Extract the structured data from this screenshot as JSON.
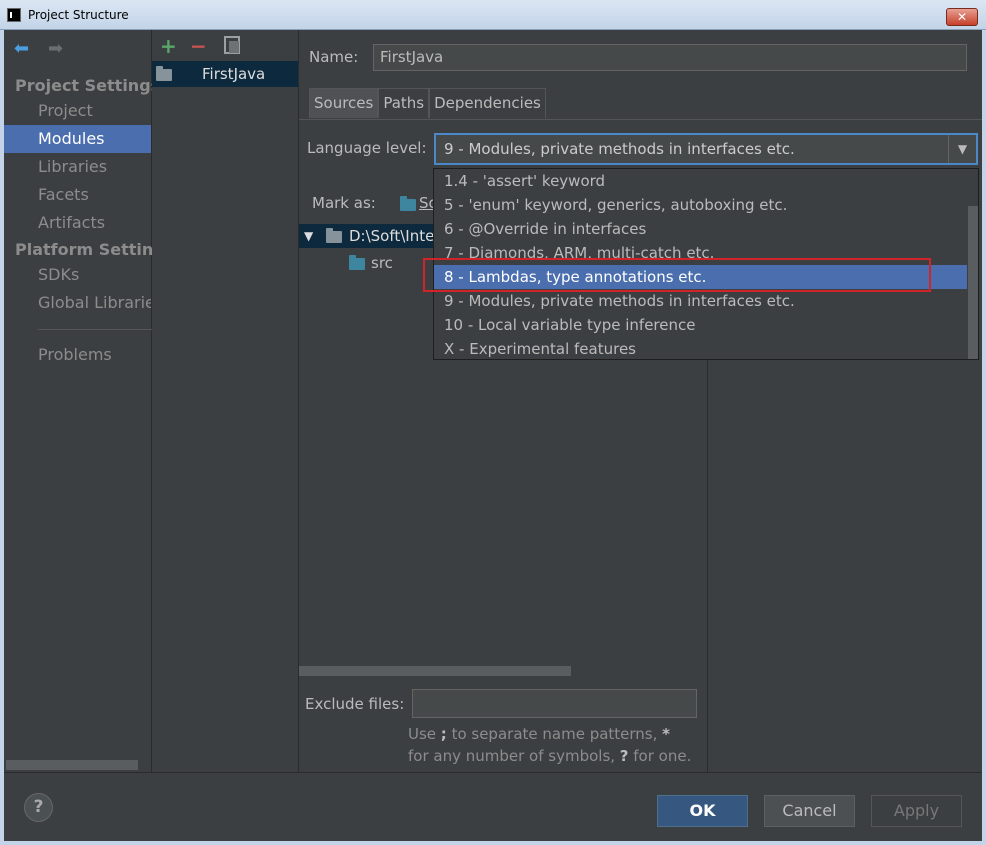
{
  "window": {
    "title": "Project Structure",
    "close_label": "✕"
  },
  "sidebar": {
    "section1": "Project Settings",
    "section1_items": [
      "Project",
      "Modules",
      "Libraries",
      "Facets",
      "Artifacts"
    ],
    "section2": "Platform Setting",
    "section2_items": [
      "SDKs",
      "Global Libraries"
    ],
    "extra_items": [
      "Problems"
    ],
    "selected": "Modules"
  },
  "modules": {
    "add": "+",
    "remove": "−",
    "items": [
      "FirstJava"
    ]
  },
  "main": {
    "name_label": "Name:",
    "name_value": "FirstJava",
    "tabs": [
      "Sources",
      "Paths",
      "Dependencies"
    ],
    "active_tab": "Sources",
    "language_label": "Language level:",
    "language_value": "9 - Modules, private methods in interfaces etc.",
    "mark_as_label": "Mark as:",
    "mark_as_first": "So",
    "tree_root": "D:\\Soft\\Inte",
    "tree_child": "src",
    "exclude_label": "Exclude files:",
    "hint_line1_a": "Use ",
    "hint_line1_b": ";",
    "hint_line1_c": " to separate name patterns, ",
    "hint_line1_d": "*",
    "hint_line2_a": "for any number of symbols, ",
    "hint_line2_b": "?",
    "hint_line2_c": " for one."
  },
  "dropdown": {
    "options": [
      "1.4 - 'assert' keyword",
      "5 - 'enum' keyword, generics, autoboxing etc.",
      "6 - @Override in interfaces",
      "7 - Diamonds, ARM, multi-catch etc.",
      "8 - Lambdas, type annotations etc.",
      "9 - Modules, private methods in interfaces etc.",
      "10 - Local variable type inference",
      "X - Experimental features"
    ],
    "highlighted": "8 - Lambdas, type annotations etc."
  },
  "buttons": {
    "help": "?",
    "ok": "OK",
    "cancel": "Cancel",
    "apply": "Apply"
  },
  "colors": {
    "selection": "#4b6eaf",
    "highlight_box": "#d1232a",
    "add": "#59a869",
    "remove": "#c75450"
  }
}
